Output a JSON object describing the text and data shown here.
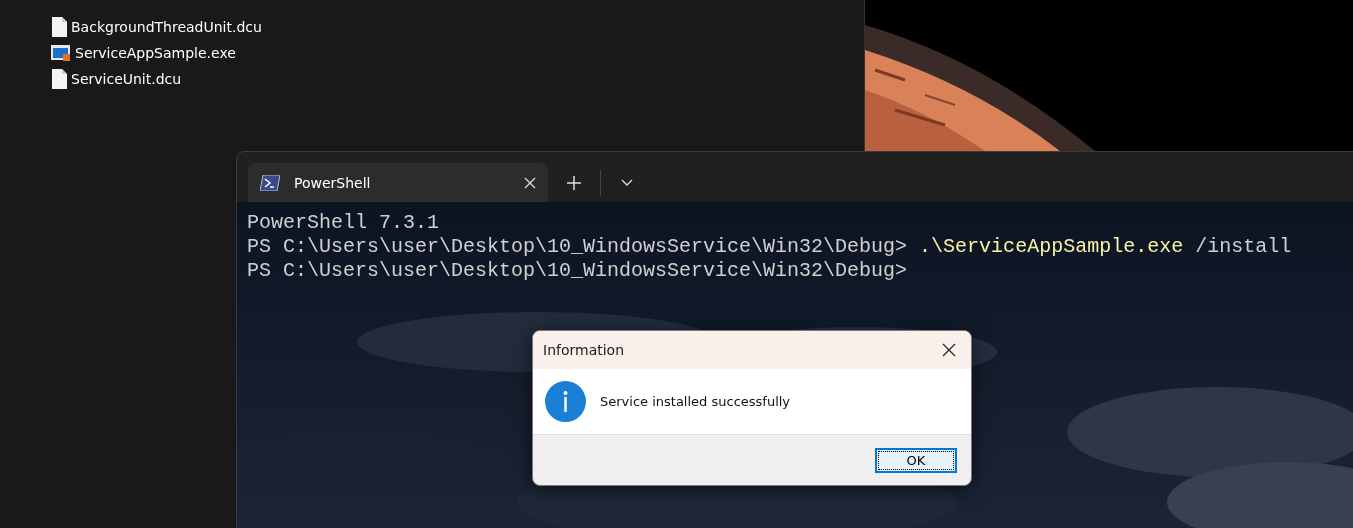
{
  "explorer": {
    "files": [
      {
        "name": "BackgroundThreadUnit.dcu",
        "kind": "document"
      },
      {
        "name": "ServiceAppSample.exe",
        "kind": "program"
      },
      {
        "name": "ServiceUnit.dcu",
        "kind": "document"
      }
    ]
  },
  "terminal": {
    "tabs": [
      {
        "label": "PowerShell",
        "selected": true
      }
    ],
    "lines": [
      {
        "segments": [
          {
            "text": "PowerShell 7.3.1",
            "kind": "output"
          }
        ]
      },
      {
        "segments": [
          {
            "text": "PS C:\\Users\\user\\Desktop\\10_WindowsService\\Win32\\Debug>",
            "kind": "prompt"
          },
          {
            "text": ".\\ServiceAppSample.exe",
            "kind": "command"
          },
          {
            "text": "/install",
            "kind": "argument"
          }
        ]
      },
      {
        "segments": [
          {
            "text": "PS C:\\Users\\user\\Desktop\\10_WindowsService\\Win32\\Debug>",
            "kind": "prompt"
          }
        ]
      }
    ]
  },
  "dialog": {
    "title": "Information",
    "message": "Service installed successfully",
    "buttons": [
      "OK"
    ]
  }
}
